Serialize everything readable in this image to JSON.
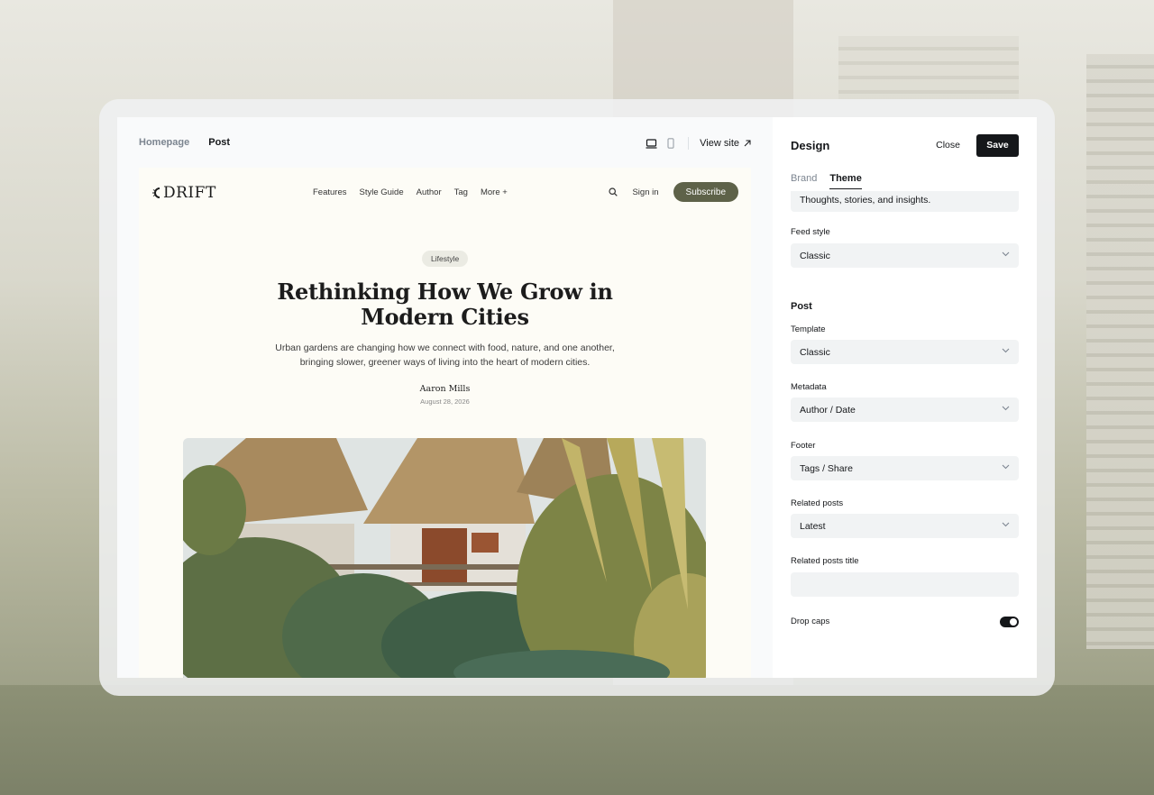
{
  "preview": {
    "tabs": [
      "Homepage",
      "Post"
    ],
    "view_site": "View site"
  },
  "site": {
    "logo": "DRIFT",
    "nav": [
      "Features",
      "Style Guide",
      "Author",
      "Tag",
      "More +"
    ],
    "sign_in": "Sign in",
    "subscribe": "Subscribe",
    "tag": "Lifestyle",
    "title": "Rethinking How We Grow in Modern Cities",
    "excerpt": "Urban gardens are changing how we connect with food, nature, and one another, bringing slower, greener ways of living into the heart of modern cities.",
    "author": "Aaron Mills",
    "date": "August 28, 2026"
  },
  "panel": {
    "title": "Design",
    "close": "Close",
    "save": "Save",
    "tabs": [
      "Brand",
      "Theme"
    ],
    "description_value": "Thoughts, stories, and insights.",
    "feed_style": {
      "label": "Feed style",
      "value": "Classic"
    },
    "post_section": "Post",
    "template": {
      "label": "Template",
      "value": "Classic"
    },
    "metadata": {
      "label": "Metadata",
      "value": "Author / Date"
    },
    "footer": {
      "label": "Footer",
      "value": "Tags / Share"
    },
    "related_posts": {
      "label": "Related posts",
      "value": "Latest"
    },
    "related_posts_title": {
      "label": "Related posts title",
      "value": ""
    },
    "drop_caps": {
      "label": "Drop caps",
      "enabled": true
    }
  },
  "colors": {
    "accent": "#15171a",
    "subscribe": "#5e6249",
    "site_bg": "#fdfcf6"
  }
}
